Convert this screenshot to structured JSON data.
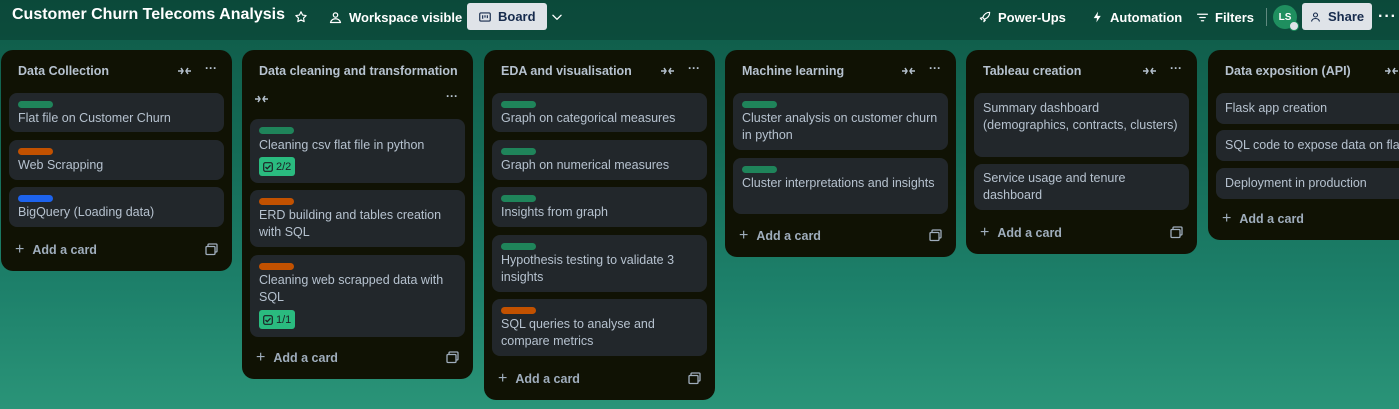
{
  "header": {
    "board_title": "Customer Churn Telecoms Analysis",
    "visibility_label": "Workspace visible",
    "view_label": "Board",
    "powerups_label": "Power-Ups",
    "automation_label": "Automation",
    "filters_label": "Filters",
    "avatar_initials": "LS",
    "share_label": "Share"
  },
  "label_colors": {
    "green": "#1f845a",
    "orange": "#c25100",
    "blue": "#1d63ed"
  },
  "lists": [
    {
      "title": "Data Collection",
      "add_card_label": "Add a card",
      "cards": [
        {
          "label": "green",
          "text": "Flat file on Customer Churn"
        },
        {
          "label": "orange",
          "text": "Web Scrapping"
        },
        {
          "label": "blue",
          "text": "BigQuery (Loading data)"
        }
      ]
    },
    {
      "title": "Data cleaning and transformation",
      "add_card_label": "Add a card",
      "cards": [
        {
          "label": "green",
          "text": "Cleaning csv flat file in python",
          "checklist": "2/2"
        },
        {
          "label": "orange",
          "text": "ERD building and tables creation with SQL"
        },
        {
          "label": "orange",
          "text": "Cleaning web scrapped data with SQL",
          "checklist": "1/1"
        }
      ]
    },
    {
      "title": "EDA and visualisation",
      "add_card_label": "Add a card",
      "cards": [
        {
          "label": "green",
          "text": "Graph on categorical measures"
        },
        {
          "label": "green",
          "text": "Graph on numerical measures"
        },
        {
          "label": "green",
          "text": "Insights from graph"
        },
        {
          "label": "green",
          "text": "Hypothesis testing to validate 3 insights"
        },
        {
          "label": "orange",
          "text": "SQL queries to analyse and compare metrics"
        }
      ]
    },
    {
      "title": "Machine learning",
      "add_card_label": "Add a card",
      "cards": [
        {
          "label": "green",
          "text": "Cluster analysis on customer churn in python"
        },
        {
          "label": "green",
          "text": "Cluster interpretations and insights"
        }
      ]
    },
    {
      "title": "Tableau creation",
      "add_card_label": "Add a card",
      "cards": [
        {
          "text": "Summary dashboard (demographics, contracts, clusters)"
        },
        {
          "text": "Service usage and tenure dashboard"
        }
      ]
    },
    {
      "title": "Data exposition (API)",
      "add_card_label": "Add a card",
      "cards": [
        {
          "text": "Flask app creation"
        },
        {
          "text": "SQL code to expose data on flask"
        },
        {
          "text": "Deployment in production"
        }
      ]
    }
  ]
}
